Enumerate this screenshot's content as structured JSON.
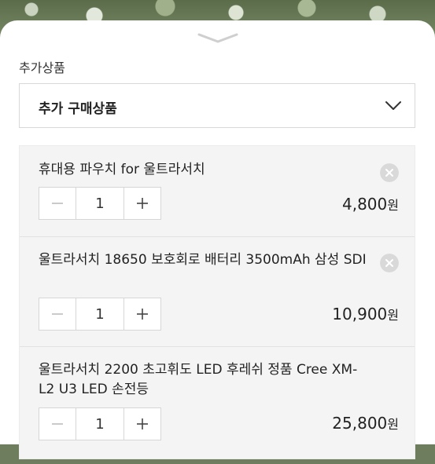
{
  "section_label": "추가상품",
  "dropdown": {
    "label": "추가 구매상품"
  },
  "items": [
    {
      "name": "휴대용 파우치 for 울트라서치",
      "quantity": "1",
      "price": "4,800",
      "currency": "원"
    },
    {
      "name": "울트라서치 18650 보호회로 배터리 3500mAh 삼성 SDI",
      "quantity": "1",
      "price": "10,900",
      "currency": "원"
    },
    {
      "name": "울트라서치 2200 초고휘도 LED 후레쉬 정품 Cree XM-L2 U3 LED 손전등",
      "quantity": "1",
      "price": "25,800",
      "currency": "원"
    }
  ],
  "icons": {
    "handle": "chevron-down-icon",
    "dropdown": "chevron-down-icon",
    "remove": "close-circle-icon",
    "decrease": "minus-icon",
    "increase": "plus-icon"
  }
}
